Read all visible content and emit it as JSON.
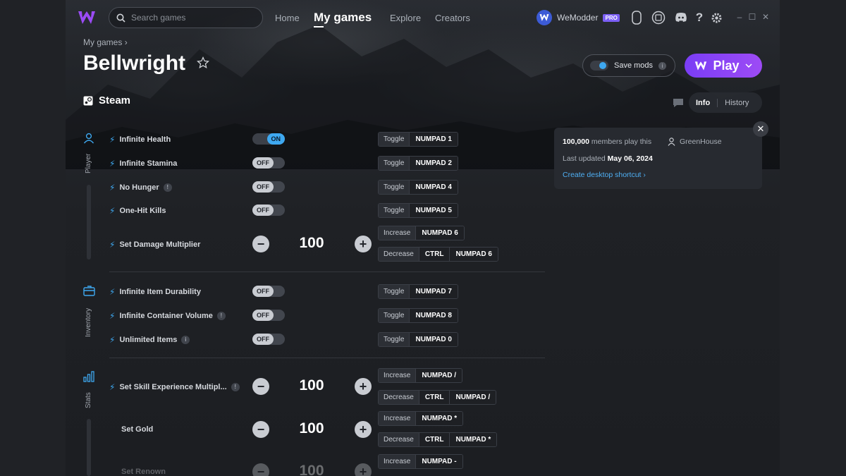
{
  "app": {
    "name": "WeModder"
  },
  "search": {
    "placeholder": "Search games"
  },
  "nav": {
    "home": "Home",
    "my_games": "My games",
    "explore": "Explore",
    "creators": "Creators"
  },
  "user": {
    "name": "WeModder",
    "badge": "PRO"
  },
  "breadcrumb": {
    "label": "My games"
  },
  "game": {
    "title": "Bellwright",
    "platform": "Steam"
  },
  "actions": {
    "save_mods": "Save mods",
    "play": "Play"
  },
  "tabs": {
    "info": "Info",
    "history": "History"
  },
  "info_card": {
    "members_count": "100,000",
    "members_text": "members play this",
    "creator": "GreenHouse",
    "updated_label": "Last updated",
    "updated_date": "May 06, 2024",
    "shortcut": "Create desktop shortcut"
  },
  "categories": {
    "player": "Player",
    "inventory": "Inventory",
    "stats": "Stats"
  },
  "cheats": [
    {
      "name": "Infinite Health",
      "state": "ON",
      "action": "Toggle",
      "keys": [
        "NUMPAD 1"
      ]
    },
    {
      "name": "Infinite Stamina",
      "state": "OFF",
      "action": "Toggle",
      "keys": [
        "NUMPAD 2"
      ]
    },
    {
      "name": "No Hunger",
      "state": "OFF",
      "action": "Toggle",
      "keys": [
        "NUMPAD 4"
      ]
    },
    {
      "name": "One-Hit Kills",
      "state": "OFF",
      "action": "Toggle",
      "keys": [
        "NUMPAD 5"
      ]
    },
    {
      "name": "Set Damage Multiplier",
      "value": "100",
      "inc_action": "Increase",
      "inc_keys": [
        "NUMPAD 6"
      ],
      "dec_action": "Decrease",
      "dec_keys": [
        "CTRL",
        "NUMPAD 6"
      ]
    },
    {
      "name": "Infinite Item Durability",
      "state": "OFF",
      "action": "Toggle",
      "keys": [
        "NUMPAD 7"
      ]
    },
    {
      "name": "Infinite Container Volume",
      "state": "OFF",
      "action": "Toggle",
      "keys": [
        "NUMPAD 8"
      ]
    },
    {
      "name": "Unlimited Items",
      "state": "OFF",
      "action": "Toggle",
      "keys": [
        "NUMPAD 0"
      ]
    },
    {
      "name": "Set Skill Experience Multipl...",
      "value": "100",
      "inc_action": "Increase",
      "inc_keys": [
        "NUMPAD /"
      ],
      "dec_action": "Decrease",
      "dec_keys": [
        "CTRL",
        "NUMPAD /"
      ]
    },
    {
      "name": "Set Gold",
      "value": "100",
      "inc_action": "Increase",
      "inc_keys": [
        "NUMPAD *"
      ],
      "dec_action": "Decrease",
      "dec_keys": [
        "CTRL",
        "NUMPAD *"
      ]
    },
    {
      "name": "Set Renown",
      "value": "100",
      "inc_action": "Increase",
      "inc_keys": [
        "NUMPAD -"
      ]
    }
  ],
  "colors": {
    "accent": "#3ea8f0",
    "play": "#8a45f5",
    "link": "#4fb0f5"
  }
}
